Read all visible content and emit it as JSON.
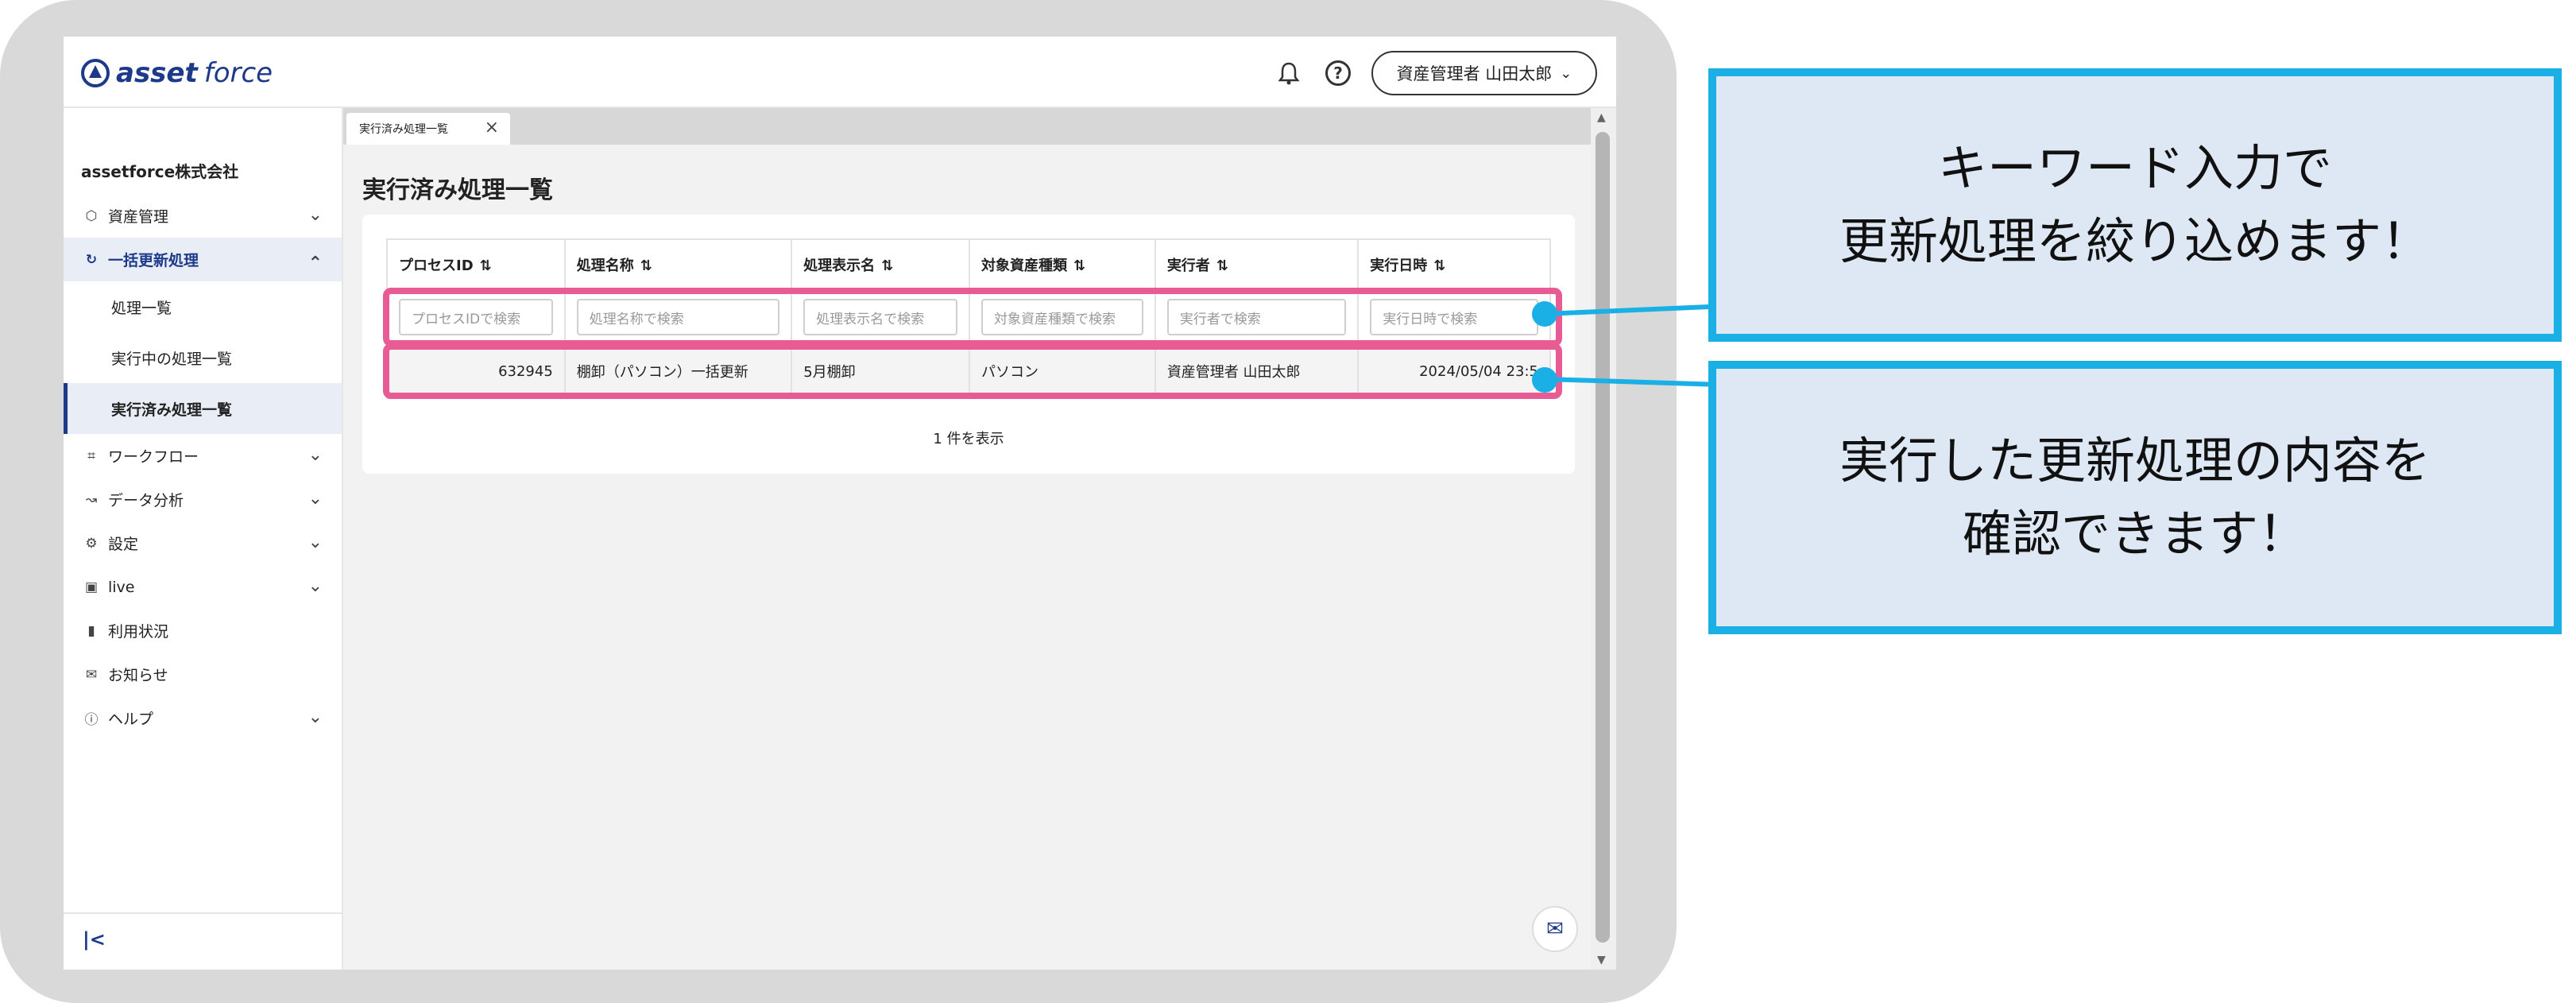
{
  "header": {
    "logo_bold": "asset",
    "logo_light": "force",
    "user_label": "資産管理者 山田太郎",
    "icons": {
      "bell": "bell-icon",
      "help": "help-icon",
      "dropdown": "chevron-down-icon"
    }
  },
  "sidebar": {
    "company": "assetforce株式会社",
    "items": [
      {
        "label": "資産管理",
        "icon": "cube-icon"
      },
      {
        "label": "一括更新処理",
        "icon": "refresh-icon"
      },
      {
        "label": "処理一覧"
      },
      {
        "label": "実行中の処理一覧"
      },
      {
        "label": "実行済み処理一覧"
      },
      {
        "label": "ワークフロー",
        "icon": "workflow-icon"
      },
      {
        "label": "データ分析",
        "icon": "analytics-icon"
      },
      {
        "label": "設定",
        "icon": "gear-icon"
      },
      {
        "label": "live",
        "icon": "live-icon"
      },
      {
        "label": "利用状況",
        "icon": "bar-chart-icon"
      },
      {
        "label": "お知らせ",
        "icon": "megaphone-icon"
      },
      {
        "label": "ヘルプ",
        "icon": "help-icon"
      }
    ]
  },
  "main": {
    "tab_label": "実行済み処理一覧",
    "page_title": "実行済み処理一覧",
    "columns": [
      "プロセスID",
      "処理名称",
      "処理表示名",
      "対象資産種類",
      "実行者",
      "実行日時"
    ],
    "filters": [
      "プロセスIDで検索",
      "処理名称で検索",
      "処理表示名で検索",
      "対象資産種類で検索",
      "実行者で検索",
      "実行日時で検索"
    ],
    "row": {
      "process_id": "632945",
      "name": "棚卸（パソコン）一括更新",
      "display_name": "5月棚卸",
      "asset_type": "パソコン",
      "executor": "資産管理者 山田太郎",
      "executed_at": "2024/05/04 23:5"
    },
    "count_label": "1 件を表示"
  },
  "callouts": {
    "top_line1": "キーワード入力で",
    "top_line2": "更新処理を絞り込めます！",
    "bottom_line1": "実行した更新処理の内容を",
    "bottom_line2": "確認できます！"
  },
  "colors": {
    "accent": "#1d3a8a",
    "highlight": "#e85c93",
    "callout_border": "#1ab0e6",
    "callout_fill": "#dde8f4",
    "link": "#2956b8"
  }
}
